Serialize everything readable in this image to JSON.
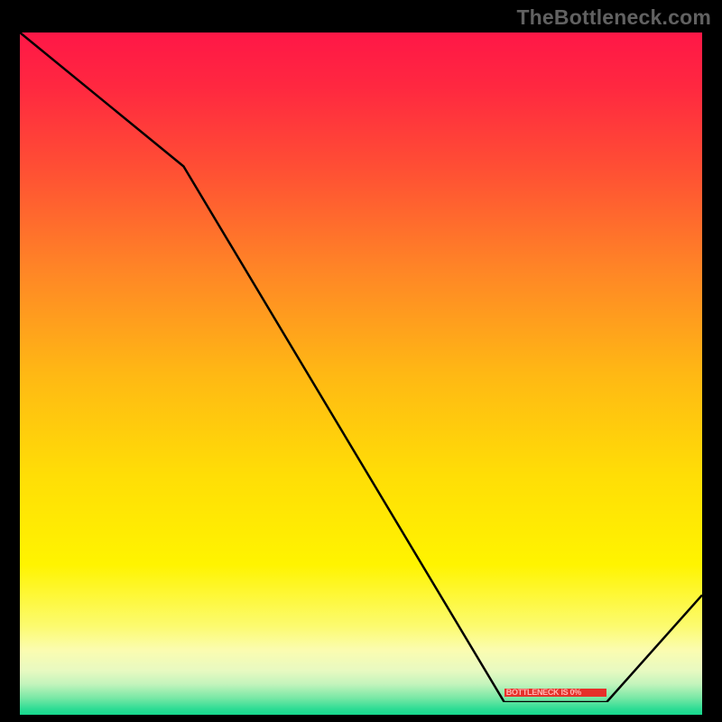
{
  "watermark": "TheBottleneck.com",
  "annotation_label": "BOTTLENECK IS 0%",
  "gradient_stops": [
    {
      "offset": 0.0,
      "color": "#ff1747"
    },
    {
      "offset": 0.08,
      "color": "#ff2840"
    },
    {
      "offset": 0.2,
      "color": "#ff4f34"
    },
    {
      "offset": 0.35,
      "color": "#ff8626"
    },
    {
      "offset": 0.5,
      "color": "#ffb814"
    },
    {
      "offset": 0.65,
      "color": "#ffde06"
    },
    {
      "offset": 0.78,
      "color": "#fff400"
    },
    {
      "offset": 0.87,
      "color": "#fcfb6f"
    },
    {
      "offset": 0.905,
      "color": "#fbfcb0"
    },
    {
      "offset": 0.935,
      "color": "#e8fac1"
    },
    {
      "offset": 0.955,
      "color": "#c3f4bc"
    },
    {
      "offset": 0.975,
      "color": "#7ae8a6"
    },
    {
      "offset": 0.992,
      "color": "#2bdc94"
    },
    {
      "offset": 1.0,
      "color": "#16d88e"
    }
  ],
  "chart_data": {
    "type": "line",
    "title": "",
    "xlabel": "",
    "ylabel": "",
    "xlim": [
      0,
      100
    ],
    "ylim": [
      0,
      100
    ],
    "notes": "x is a normalized horizontal position across the plot (0 = left edge, 100 = right edge). y is a normalized value where 100 = top of colored area and 0 = bottom (green). The series traces a bottleneck curve that falls from 100 at the left, kinks near x≈24, reaches 0 around x≈71–86 (the green optimal band), then rises toward the right edge.",
    "series": [
      {
        "name": "bottleneck-curve",
        "x": [
          0,
          24,
          71,
          86,
          100
        ],
        "y": [
          100,
          80,
          0,
          0,
          16
        ]
      }
    ],
    "annotation": {
      "text": "BOTTLENECK IS 0%",
      "x_range": [
        71,
        86
      ],
      "y": 0.8
    }
  }
}
